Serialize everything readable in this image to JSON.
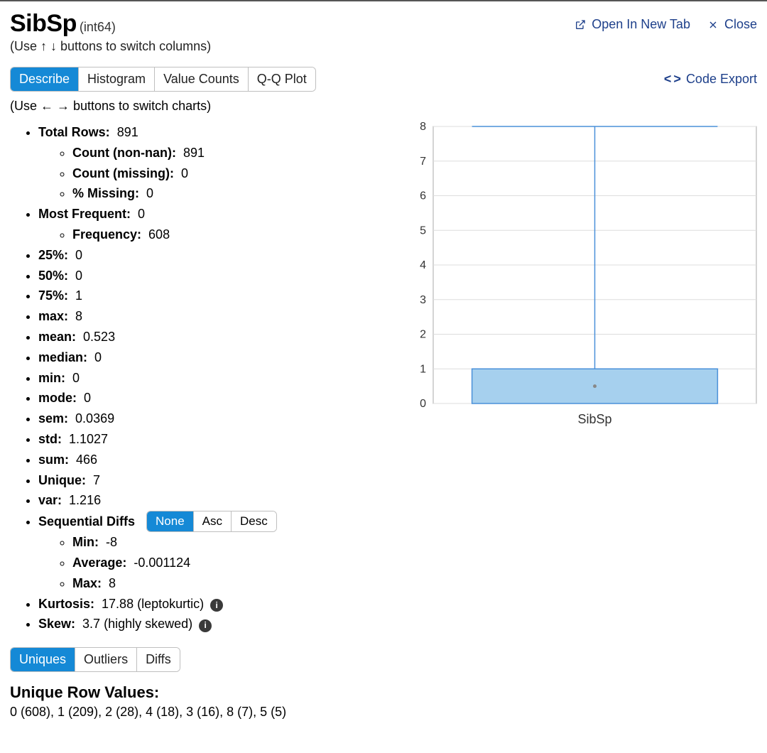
{
  "header": {
    "title": "SibSp",
    "dtype": "(int64)",
    "hint_columns": "(Use ↑ ↓ buttons to switch columns)",
    "open_new_tab": "Open In New Tab",
    "close": "Close"
  },
  "tabs": {
    "describe": "Describe",
    "histogram": "Histogram",
    "value_counts": "Value Counts",
    "qqplot": "Q-Q Plot",
    "code_export": "Code Export",
    "hint_charts": "(Use ← → buttons to switch charts)"
  },
  "stats": {
    "total_rows": {
      "label": "Total Rows:",
      "value": "891"
    },
    "count_nonnan": {
      "label": "Count (non-nan):",
      "value": "891"
    },
    "count_missing": {
      "label": "Count (missing):",
      "value": "0"
    },
    "pct_missing": {
      "label": "% Missing:",
      "value": "0"
    },
    "most_frequent": {
      "label": "Most Frequent:",
      "value": "0"
    },
    "frequency": {
      "label": "Frequency:",
      "value": "608"
    },
    "p25": {
      "label": "25%:",
      "value": "0"
    },
    "p50": {
      "label": "50%:",
      "value": "0"
    },
    "p75": {
      "label": "75%:",
      "value": "1"
    },
    "max": {
      "label": "max:",
      "value": "8"
    },
    "mean": {
      "label": "mean:",
      "value": "0.523"
    },
    "median": {
      "label": "median:",
      "value": "0"
    },
    "min": {
      "label": "min:",
      "value": "0"
    },
    "mode": {
      "label": "mode:",
      "value": "0"
    },
    "sem": {
      "label": "sem:",
      "value": "0.0369"
    },
    "std": {
      "label": "std:",
      "value": "1.1027"
    },
    "sum": {
      "label": "sum:",
      "value": "466"
    },
    "unique": {
      "label": "Unique:",
      "value": "7"
    },
    "var": {
      "label": "var:",
      "value": "1.216"
    },
    "seq_label": "Sequential Diffs",
    "seq_none": "None",
    "seq_asc": "Asc",
    "seq_desc": "Desc",
    "seq_min": {
      "label": "Min:",
      "value": "-8"
    },
    "seq_avg": {
      "label": "Average:",
      "value": "-0.001124"
    },
    "seq_max": {
      "label": "Max:",
      "value": "8"
    },
    "kurtosis": {
      "label": "Kurtosis:",
      "value": "17.88 (leptokurtic)"
    },
    "skew": {
      "label": "Skew:",
      "value": "3.7 (highly skewed)"
    }
  },
  "bottom_tabs": {
    "uniques": "Uniques",
    "outliers": "Outliers",
    "diffs": "Diffs"
  },
  "unique_section": {
    "label": "Unique Row Values:",
    "values": "0 (608), 1 (209), 2 (28), 4 (18), 3 (16), 8 (7), 5 (5)"
  },
  "chart_data": {
    "type": "box",
    "xlabel": "SibSp",
    "y_ticks": [
      0,
      1,
      2,
      3,
      4,
      5,
      6,
      7,
      8
    ],
    "box": {
      "q1": 0,
      "median": 0.5,
      "q3": 1,
      "whisker_low": 0,
      "whisker_high": 8
    }
  }
}
